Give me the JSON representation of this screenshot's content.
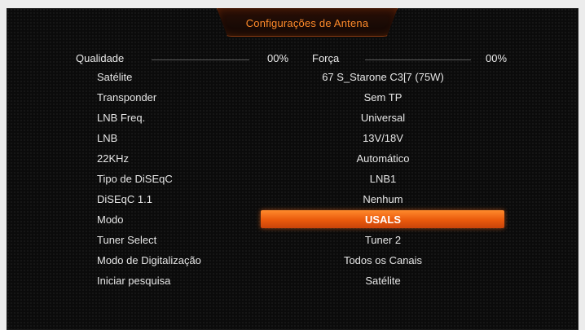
{
  "screen": {
    "title": "Configurações de Antena"
  },
  "meters": {
    "quality_label": "Qualidade",
    "quality_value": "00%",
    "strength_label": "Força",
    "strength_value": "00%"
  },
  "settings": [
    {
      "label": "Satélite",
      "value": "67 S_Starone C3[7 (75W)"
    },
    {
      "label": "Transponder",
      "value": "Sem TP"
    },
    {
      "label": "LNB Freq.",
      "value": "Universal"
    },
    {
      "label": "LNB",
      "value": "13V/18V"
    },
    {
      "label": "22KHz",
      "value": "Automático"
    },
    {
      "label": "Tipo de DiSEqC",
      "value": "LNB1"
    },
    {
      "label": "DiSEqC 1.1",
      "value": "Nenhum"
    },
    {
      "label": "Modo",
      "value": "USALS"
    },
    {
      "label": "Tuner Select",
      "value": "Tuner 2"
    },
    {
      "label": "Modo de Digitalização",
      "value": "Todos os Canais"
    },
    {
      "label": "Iniciar pesquisa",
      "value": "Satélite"
    }
  ],
  "selected_index": 7,
  "colors": {
    "accent": "#ea5a0c",
    "title_text": "#ff8a2a",
    "background": "#0b0b0b"
  }
}
